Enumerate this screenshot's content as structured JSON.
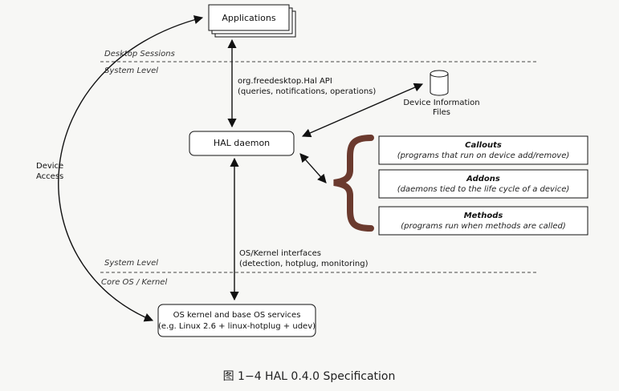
{
  "nodes": {
    "applications": "Applications",
    "hal_daemon": "HAL daemon",
    "device_info_line1": "Device Information",
    "device_info_line2": "Files",
    "os_kernel_line1": "OS kernel and base OS services",
    "os_kernel_line2": "(e.g. Linux 2.6 + linux-hotplug + udev)",
    "callouts_title": "Callouts",
    "callouts_desc": "(programs that run on device add/remove)",
    "addons_title": "Addons",
    "addons_desc": "(daemons tied to the life cycle of a device)",
    "methods_title": "Methods",
    "methods_desc": "(programs run when methods are called)"
  },
  "edges": {
    "hal_api_line1": "org.freedesktop.Hal API",
    "hal_api_line2": "(queries, notifications, operations)",
    "kernel_if_line1": "OS/Kernel interfaces",
    "kernel_if_line2": "(detection, hotplug, monitoring)",
    "device_access_line1": "Device",
    "device_access_line2": "Access"
  },
  "zones": {
    "desktop_sessions": "Desktop Sessions",
    "system_level_top": "System Level",
    "system_level_bottom": "System Level",
    "core_os": "Core OS / Kernel"
  },
  "caption": "图 1−4    HAL 0.4.0 Specification",
  "colors": {
    "line": "#111111",
    "brace": "#6b3a2e",
    "page": "#f7f7f5",
    "box_fill": "#ffffff"
  }
}
